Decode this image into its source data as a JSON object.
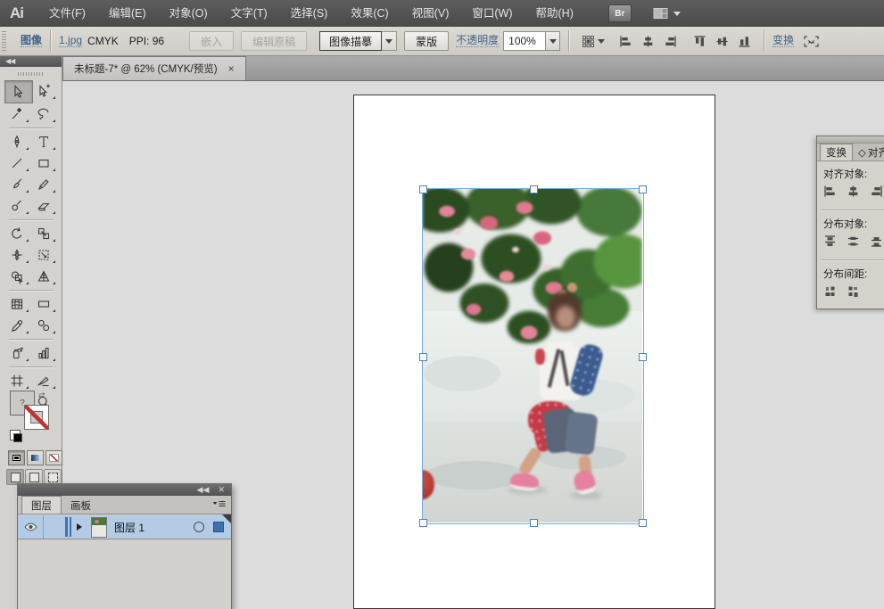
{
  "app": {
    "logo": "Ai",
    "bridge_label": "Br"
  },
  "menubar": {
    "items": [
      "文件(F)",
      "编辑(E)",
      "对象(O)",
      "文字(T)",
      "选择(S)",
      "效果(C)",
      "视图(V)",
      "窗口(W)",
      "帮助(H)"
    ]
  },
  "controlbar": {
    "selection_type": "图像",
    "file_link": "1.jpg",
    "color_mode": "CMYK",
    "ppi": "PPI: 96",
    "embed_button": "嵌入",
    "edit_original_button": "编辑原稿",
    "image_trace_button": "图像描摹",
    "mask_button": "蒙版",
    "opacity_label": "不透明度",
    "opacity_value": "100%",
    "transform_link": "变换"
  },
  "document_tab": {
    "title": "未标题-7* @ 62% (CMYK/预览)",
    "close": "×"
  },
  "toolpanel": {
    "collapse_glyph": "◀◀",
    "fill_unknown_glyph": "?"
  },
  "align_panel": {
    "tab_transform": "变换",
    "align_marker": "◇",
    "tab_align": "对齐",
    "align_objects_label": "对齐对象:",
    "distribute_objects_label": "分布对象:",
    "distribute_spacing_label": "分布间距:"
  },
  "layers_panel": {
    "collapse_glyph": "◀◀",
    "close_glyph": "✕",
    "tab_layers": "图层",
    "tab_artboards": "画板",
    "rows": [
      {
        "name": "图层 1"
      }
    ]
  },
  "colors": {
    "link_blue": "#3f6489",
    "selection_blue": "#74a9d6",
    "layer_row_highlight": "#b3cbe5",
    "menubar_gray": "#515151",
    "panel_gray": "#d5d2cc"
  }
}
